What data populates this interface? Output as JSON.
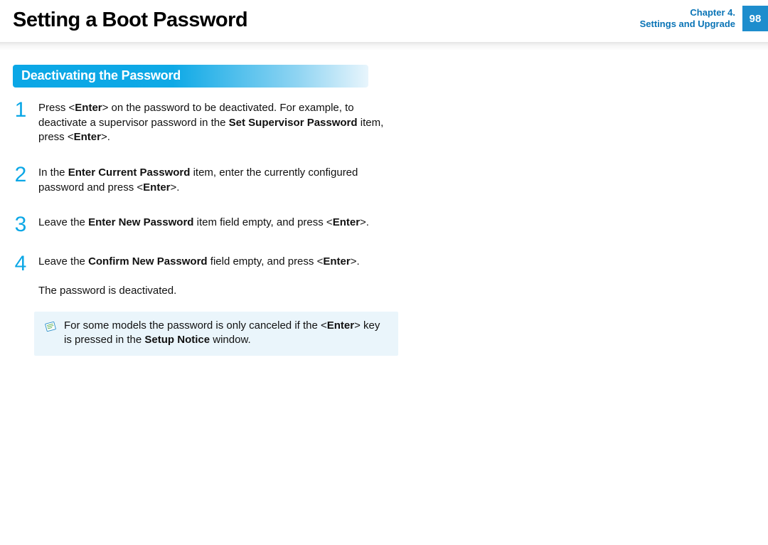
{
  "header": {
    "title": "Setting a Boot Password",
    "chapter_line1": "Chapter 4.",
    "chapter_line2": "Settings and Upgrade",
    "page_number": "98"
  },
  "section": {
    "heading": "Deactivating the Password"
  },
  "steps": {
    "s1": {
      "num": "1",
      "p1a": "Press <",
      "p1b": "Enter",
      "p1c": "> on the password to be deactivated. For example, to deactivate a supervisor password in the ",
      "p1d": "Set Supervisor Password",
      "p1e": " item, press <",
      "p1f": "Enter",
      "p1g": ">."
    },
    "s2": {
      "num": "2",
      "p1a": "In the ",
      "p1b": "Enter Current Password",
      "p1c": " item, enter the currently configured password and press <",
      "p1d": "Enter",
      "p1e": ">."
    },
    "s3": {
      "num": "3",
      "p1a": "Leave the ",
      "p1b": "Enter New Password",
      "p1c": " item field empty, and press <",
      "p1d": "Enter",
      "p1e": ">."
    },
    "s4": {
      "num": "4",
      "p1a": "Leave the ",
      "p1b": "Confirm New Password",
      "p1c": " field empty, and press <",
      "p1d": "Enter",
      "p1e": ">.",
      "p2": "The password is deactivated."
    }
  },
  "note": {
    "t1": "For some models the password is only canceled if the <",
    "t2": "Enter",
    "t3": "> key is pressed in the ",
    "t4": "Setup Notice",
    "t5": " window."
  }
}
